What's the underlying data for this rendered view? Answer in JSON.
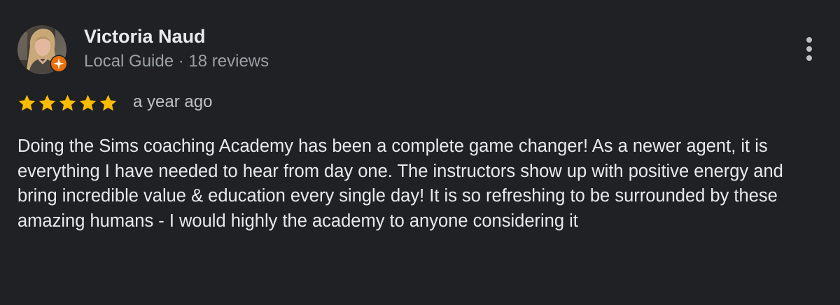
{
  "reviewer": {
    "name": "Victoria Naud",
    "meta": "Local Guide · 18 reviews",
    "avatar_icon": "user-photo-avatar",
    "badge_icon": "local-guide-badge-icon"
  },
  "review": {
    "rating": 5,
    "rating_max": 5,
    "time": "a year ago",
    "text": "Doing the Sims coaching Academy has been a complete game changer! As a newer agent, it is everything I have needed to hear from day one. The instructors show up with positive energy and bring incredible value & education every single day! It is so refreshing to be surrounded by these amazing humans - I would highly the academy to anyone considering it"
  },
  "actions": {
    "more_icon": "more-vert-icon"
  },
  "colors": {
    "background": "#202124",
    "star": "#fbbc04",
    "badge": "#e8710a",
    "name": "#e8eaed",
    "meta": "#9aa0a6"
  }
}
